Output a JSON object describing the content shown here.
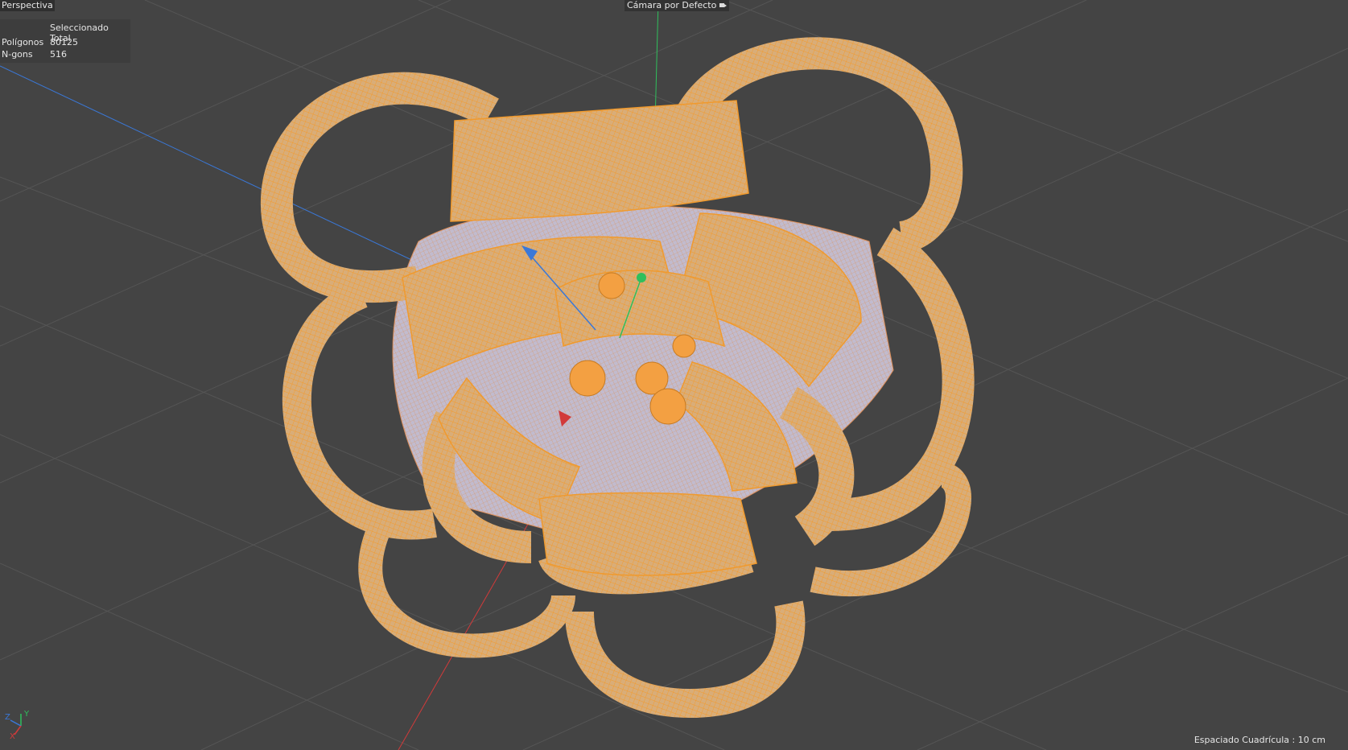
{
  "viewport": {
    "view_name": "Perspectiva",
    "camera_name": "Cámara por Defecto",
    "camera_icon": "camera-icon",
    "stats": {
      "header": "Seleccionado Total",
      "rows": [
        {
          "label": "Polígonos",
          "value": "80125"
        },
        {
          "label": "N-gons",
          "value": "516"
        }
      ]
    },
    "grid_spacing": "Espaciado Cuadrícula : 10 cm",
    "axis_labels": {
      "x": "X",
      "y": "Y",
      "z": "Z"
    }
  },
  "colors": {
    "background": "#444444",
    "grid": "#5a5a5a",
    "mesh_fill": "#d7a56a",
    "mesh_wire": "#f5a030",
    "inner_fill": "#c9c3d6",
    "axis_x": "#d23a3a",
    "axis_y": "#2fbf5c",
    "axis_z": "#3a78d8"
  }
}
